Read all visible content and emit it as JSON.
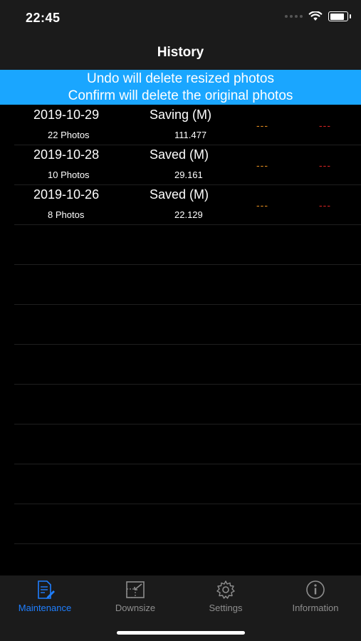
{
  "status_bar": {
    "time": "22:45",
    "icons": [
      "signal-dots-icon",
      "wifi-icon",
      "battery-icon"
    ],
    "battery_level": 0.85
  },
  "navbar": {
    "title": "History"
  },
  "banner": {
    "line1": "Undo will delete resized photos",
    "line2": "Confirm will delete the original photos",
    "background": "#1aa6ff"
  },
  "history": [
    {
      "date": "2019-10-29",
      "status": "Saving (M)",
      "count": "22 Photos",
      "size": "111.477",
      "undo": "---",
      "confirm": "---"
    },
    {
      "date": "2019-10-28",
      "status": "Saved (M)",
      "count": "10 Photos",
      "size": "29.161",
      "undo": "---",
      "confirm": "---"
    },
    {
      "date": "2019-10-26",
      "status": "Saved (M)",
      "count": "8 Photos",
      "size": "22.129",
      "undo": "---",
      "confirm": "---"
    }
  ],
  "colors": {
    "undo": "#e08a1e",
    "confirm": "#d32222",
    "active_tab": "#1f7fff",
    "inactive_tab": "#8e8e8e"
  },
  "tabs": [
    {
      "label": "Maintenance",
      "icon": "document-edit-icon",
      "active": true
    },
    {
      "label": "Downsize",
      "icon": "resize-icon",
      "active": false
    },
    {
      "label": "Settings",
      "icon": "gear-icon",
      "active": false
    },
    {
      "label": "Information",
      "icon": "info-icon",
      "active": false
    }
  ]
}
